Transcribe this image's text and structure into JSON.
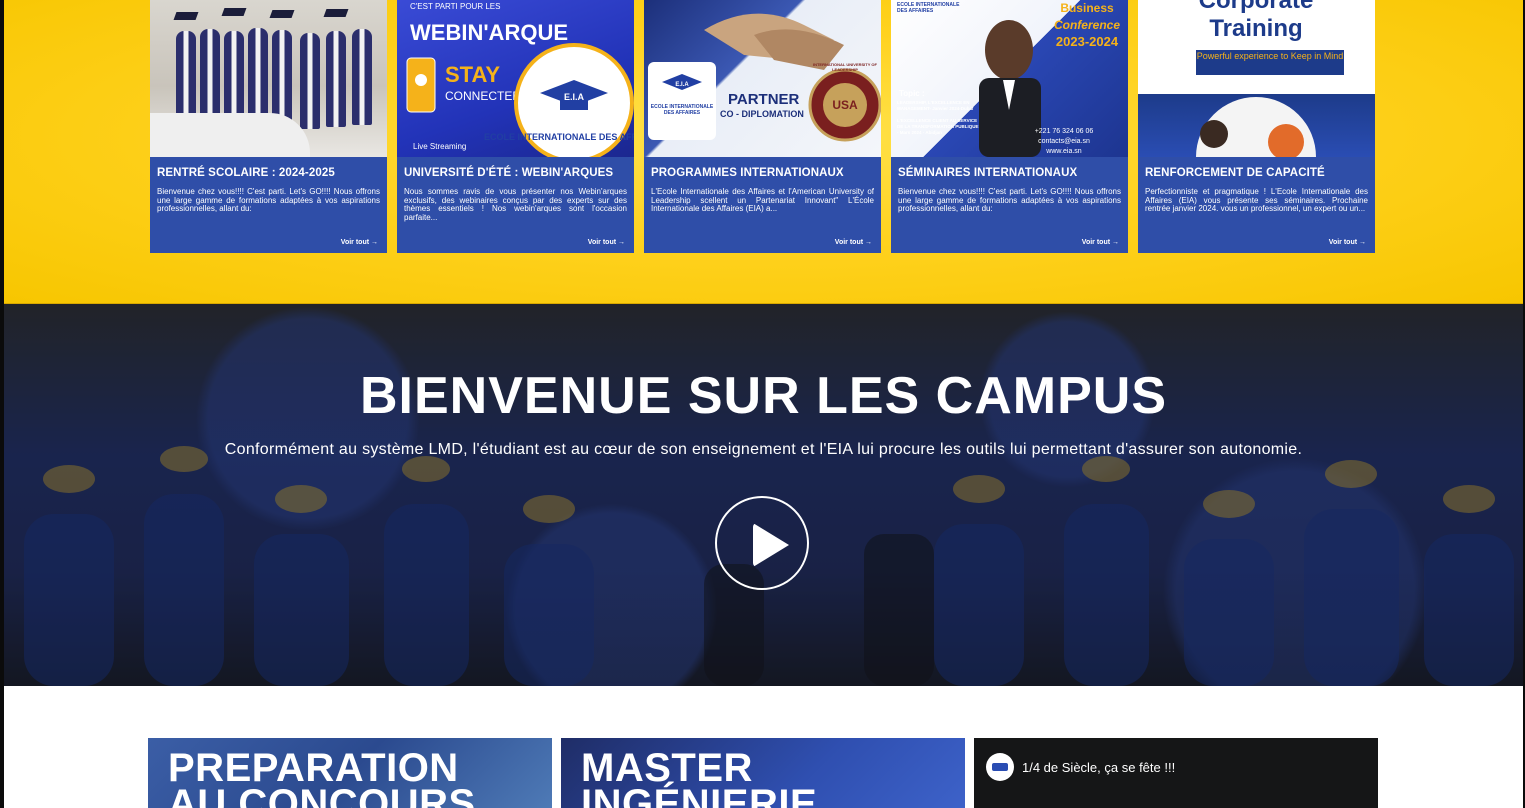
{
  "cards": [
    {
      "title": "RENTRÉ SCOLAIRE : 2024-2025",
      "text": "Bienvenue chez vous!!!! C'est parti. Let's GO!!!! Nous offrons une large gamme de formations adaptées à vos aspirations professionnelles, allant du:",
      "more": "Voir tout →"
    },
    {
      "title": "UNIVERSITÉ D'ÉTÉ : WEBIN'ARQUES",
      "text": "Nous sommes ravis de vous présenter nos Webin'arques exclusifs, des webinaires conçus par des experts sur des thèmes essentiels ! Nos webin'arques sont l'occasion parfaite...",
      "more": "Voir tout →",
      "img_head": "C'EST PARTI POUR LES",
      "img_title": "WEBIN'ARQUE",
      "img_stay": "STAY",
      "img_connected": "CONNECTED",
      "img_eia": "E.I.A",
      "img_school": "ECOLE INTERNATIONALE DES AFFAIRES",
      "img_stream": "Live Streaming"
    },
    {
      "title": "PROGRAMMES INTERNATIONAUX",
      "text": "L'École Internationale des Affaires et l'American University of Leadership scellent un Partenariat Innovant\" L'École Internationale des Affaires (EIA) a...",
      "more": "Voir tout →",
      "img_eia": "E.I.A",
      "img_school": "ECOLE INTERNATIONALE DES AFFAIRES",
      "img_partner": "PARTNER",
      "img_codiplo": "CO - DIPLOMATION",
      "img_usa": "USA",
      "img_seal": "INTERNATIONAL UNIVERSITY OF LEADERSHIP"
    },
    {
      "title": "SÉMINAIRES INTERNATIONAUX",
      "text": "Bienvenue chez vous!!!! C'est parti. Let's GO!!!! Nous offrons une large gamme de formations adaptées à vos aspirations professionnelles, allant du:",
      "more": "Voir tout →",
      "img_school": "ECOLE INTERNATIONALE DES AFFAIRES",
      "img_business": "Business",
      "img_conf": "Conference",
      "img_year": "2023-2024",
      "img_topic": "Topic :",
      "img_topic1": "LEADERSHIP, L'EXCELLENCE EN MANAGEMENT- Janvier 2024-Dubaï",
      "img_topic2": "L'EXCELLENCE CLIENT AU SERVICE DE LA TRANSFORMATION PUBLIQUE - Mars 2024 - Abidjan",
      "img_phone": "+221 76 324 06 06",
      "img_mail": "contacts@eia.sn",
      "img_web": "www.eia.sn"
    },
    {
      "title": "RENFORCEMENT DE CAPACITÉ",
      "text": "Perfectionniste et pragmatique ! L'Ecole Internationale des Affaires (EIA) vous présente ses séminaires. Prochaine rentrée janvier 2024. vous un professionnel, un expert ou un...",
      "more": "Voir tout →",
      "img_title1": "Corporate",
      "img_title2": "Training",
      "img_tag": "Powerful experience to Keep in Mind"
    }
  ],
  "hero": {
    "title": "BIENVENUE SUR LES CAMPUS",
    "subtitle": "Conformément au système LMD, l'étudiant est au cœur de son enseignement et l'EIA  lui procure les outils lui permettant d'assurer son autonomie."
  },
  "promos": [
    {
      "title_line1": "PREPARATION",
      "title_line2": "AU CONCOURS"
    },
    {
      "title_line1": "MASTER",
      "title_line2": "INGÉNIERIE"
    },
    {
      "video_title": "1/4 de Siècle, ça se fête !!!"
    }
  ],
  "colors": {
    "accent_yellow": "#ffd21f",
    "card_blue": "#2f4ea8",
    "white": "#ffffff"
  },
  "icons": {
    "play": "play-icon",
    "arrow": "arrow-right-icon"
  }
}
